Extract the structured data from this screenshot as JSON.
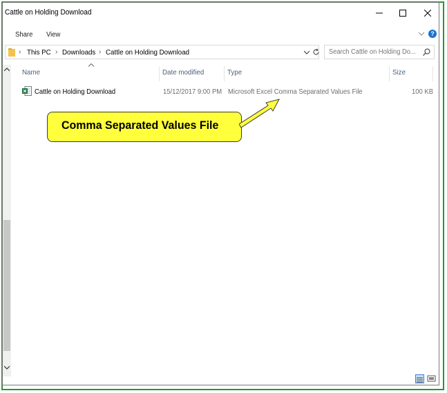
{
  "window": {
    "title": "Cattle on Holding Download"
  },
  "ribbon": {
    "tabs": [
      "Share",
      "View"
    ]
  },
  "address": {
    "crumbs": [
      "This PC",
      "Downloads",
      "Cattle on Holding Download"
    ]
  },
  "search": {
    "placeholder": "Search Cattle on Holding Do..."
  },
  "columns": {
    "name": "Name",
    "date": "Date modified",
    "type": "Type",
    "size": "Size"
  },
  "files": [
    {
      "name": "Cattle on Holding Download",
      "date": "15/12/2017 9:00 PM",
      "type": "Microsoft Excel Comma Separated Values File",
      "size": "100 KB",
      "icon": "excel-csv-icon"
    }
  ],
  "callout": {
    "text": "Comma Separated Values File",
    "color": "#ffff3c"
  },
  "colors": {
    "frame": "#1f9a2c",
    "column_header": "#4c607a",
    "help": "#1a6fd3"
  }
}
